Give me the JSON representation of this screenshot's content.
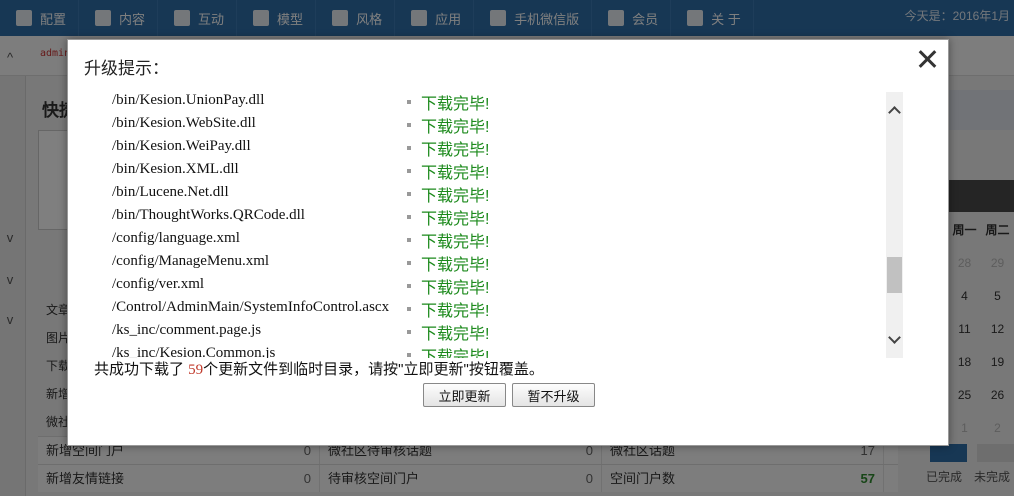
{
  "topnav": {
    "items": [
      {
        "label": "配置",
        "icon": "gear-icon"
      },
      {
        "label": "内容",
        "icon": "document-icon"
      },
      {
        "label": "互动",
        "icon": "users-icon"
      },
      {
        "label": "模型",
        "icon": "grid-icon"
      },
      {
        "label": "风格",
        "icon": "tag-icon"
      },
      {
        "label": "应用",
        "icon": "monitor-icon"
      },
      {
        "label": "手机微信版",
        "icon": "list-icon"
      },
      {
        "label": "会员",
        "icon": "user-icon"
      },
      {
        "label": "关 于",
        "icon": "menu-icon"
      }
    ],
    "today_text": "今天是：2016年1月"
  },
  "background": {
    "admin_text": "admin",
    "quick_title": "快捷",
    "left_list": [
      "文章",
      "图片",
      "下载",
      "新增",
      "微社"
    ],
    "stats": [
      [
        {
          "label": "新增空间门户",
          "value": "0"
        },
        {
          "label": "微社区待审核话题",
          "value": "0"
        },
        {
          "label": "微社区话题",
          "value": "17"
        }
      ],
      [
        {
          "label": "新增友情链接",
          "value": "0"
        },
        {
          "label": "待审核空间门户",
          "value": "0"
        },
        {
          "label": "空间门户数",
          "value": "57"
        }
      ]
    ],
    "calendar": {
      "weekdays": [
        "周一",
        "周二"
      ],
      "rows": [
        [
          "28",
          "29"
        ],
        [
          "4",
          "5"
        ],
        [
          "11",
          "12"
        ],
        [
          "18",
          "19"
        ],
        [
          "25",
          "26"
        ],
        [
          "1",
          "2"
        ]
      ]
    },
    "legend": [
      "已完成",
      "未完成"
    ]
  },
  "modal": {
    "title": "升级提示：",
    "status_text": "下载完毕!",
    "files": [
      "/bin/Kesion.UnionPay.dll",
      "/bin/Kesion.WebSite.dll",
      "/bin/Kesion.WeiPay.dll",
      "/bin/Kesion.XML.dll",
      "/bin/Lucene.Net.dll",
      "/bin/ThoughtWorks.QRCode.dll",
      "/config/language.xml",
      "/config/ManageMenu.xml",
      "/config/ver.xml",
      "/Control/AdminMain/SystemInfoControl.ascx",
      "/ks_inc/comment.page.js",
      "/ks_inc/Kesion.Common.js"
    ],
    "scroll_position": 0.82,
    "summary_prefix": "共成功下载了 ",
    "summary_count": "59",
    "summary_suffix": "个更新文件到临时目录，请按\"立即更新\"按钮覆盖。",
    "update_button": "立即更新",
    "skip_button": "暂不升级"
  }
}
